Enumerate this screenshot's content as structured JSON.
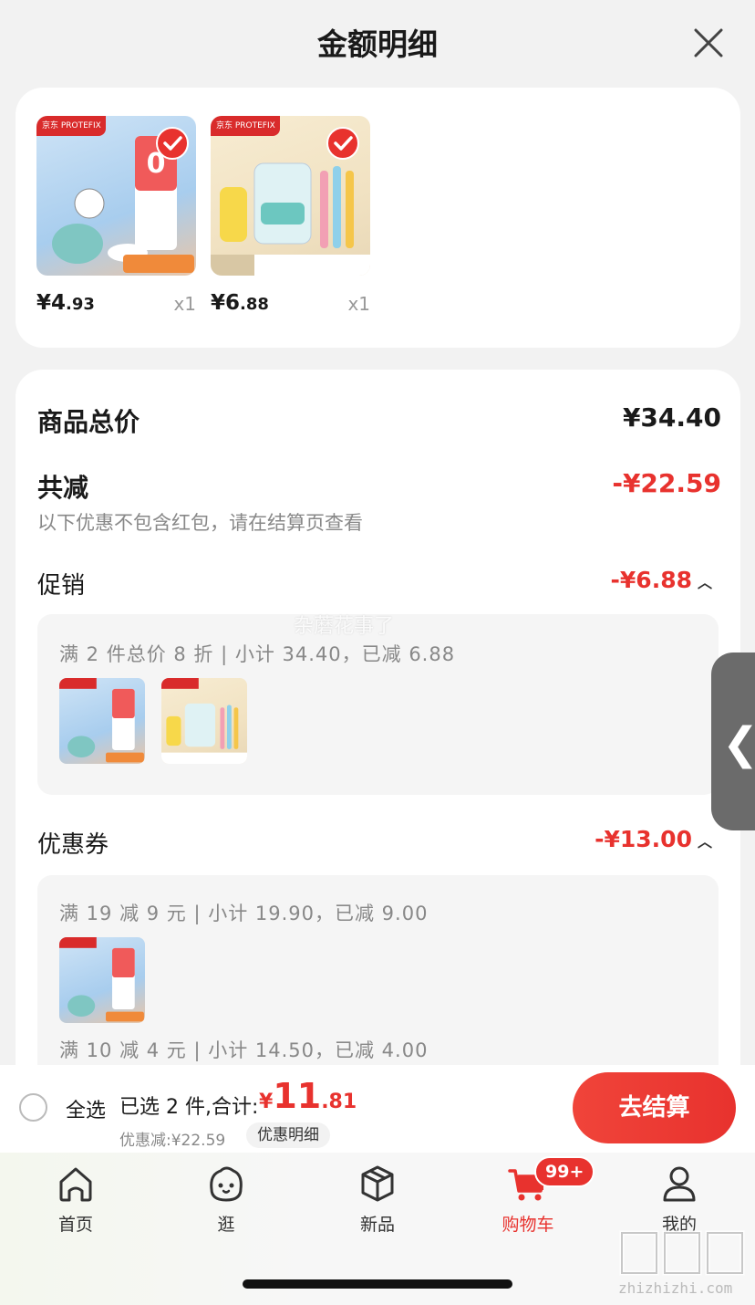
{
  "header": {
    "title": "金额明细"
  },
  "products": [
    {
      "price_int": "¥4",
      "price_dec": ".93",
      "qty": "x1",
      "brand": "京东 PROTEFIX",
      "selected": true
    },
    {
      "price_int": "¥6",
      "price_dec": ".88",
      "qty": "x1",
      "brand": "京东 PROTEFIX",
      "selected": true
    }
  ],
  "summary": {
    "total_label": "商品总价",
    "total_value": "¥34.40",
    "discount_label": "共减",
    "discount_value": "-¥22.59",
    "note": "以下优惠不包含红包，请在结算页查看",
    "promotion_label": "促销",
    "promotion_value": "-¥6.88",
    "promotion_rule": "满 2 件总价 8 折 | 小计 34.40，已减 6.88",
    "coupon_label": "优惠券",
    "coupon_value": "-¥13.00",
    "coupon_rule_1": "满 19 减 9 元 | 小计 19.90，已减 9.00",
    "coupon_rule_2": "满 10 减 4 元 | 小计 14.50，已减 4.00"
  },
  "overlay_text": "杂蘑花事了",
  "side_tab": {
    "glyph": "❮"
  },
  "bottom_bar": {
    "select_all": "全选",
    "selected": "已选 2 件,合计:",
    "currency": "¥",
    "total_int": "11",
    "total_dec": ".81",
    "discount_line": "优惠减:¥22.59",
    "detail_chip": "优惠明细",
    "checkout": "去结算"
  },
  "tabs": [
    {
      "label": "首页",
      "icon": "home-icon"
    },
    {
      "label": "逛",
      "icon": "face-icon"
    },
    {
      "label": "新品",
      "icon": "box-icon"
    },
    {
      "label": "购物车",
      "icon": "cart-icon",
      "active": true
    },
    {
      "label": "我的",
      "icon": "person-icon"
    }
  ],
  "cart_badge": "99+",
  "site": {
    "url": "zhizhizhi.com"
  },
  "colors": {
    "accent": "#e8322e",
    "background": "#f2f2f2"
  }
}
